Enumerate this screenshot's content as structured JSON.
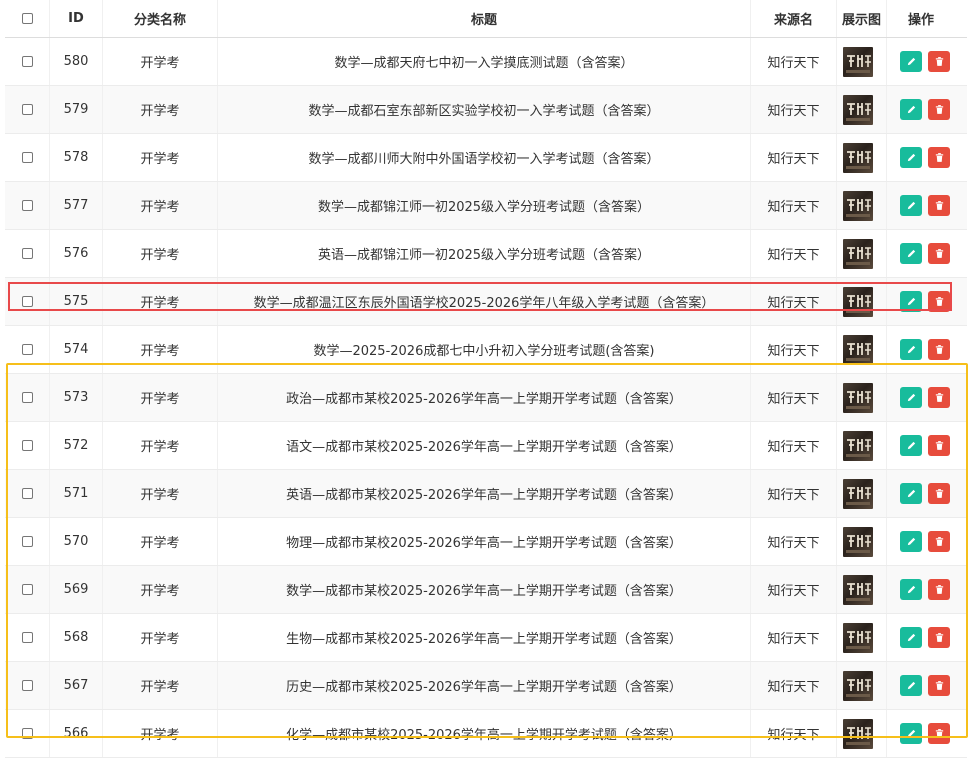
{
  "header": {
    "id": "ID",
    "category": "分类名称",
    "title": "标题",
    "source": "来源名",
    "image": "展示图",
    "actions": "操作"
  },
  "rows": [
    {
      "id": "580",
      "category": "开学考",
      "title": "数学—成都天府七中初一入学摸底测试题（含答案）",
      "source": "知行天下"
    },
    {
      "id": "579",
      "category": "开学考",
      "title": "数学—成都石室东部新区实验学校初一入学考试题（含答案）",
      "source": "知行天下"
    },
    {
      "id": "578",
      "category": "开学考",
      "title": "数学—成都川师大附中外国语学校初一入学考试题（含答案）",
      "source": "知行天下"
    },
    {
      "id": "577",
      "category": "开学考",
      "title": "数学—成都锦江师一初2025级入学分班考试题（含答案）",
      "source": "知行天下"
    },
    {
      "id": "576",
      "category": "开学考",
      "title": "英语—成都锦江师一初2025级入学分班考试题（含答案）",
      "source": "知行天下"
    },
    {
      "id": "575",
      "category": "开学考",
      "title": "数学—成都温江区东辰外国语学校2025-2026学年八年级入学考试题（含答案）",
      "source": "知行天下"
    },
    {
      "id": "574",
      "category": "开学考",
      "title": "数学—2025-2026成都七中小升初入学分班考试题(含答案)",
      "source": "知行天下"
    },
    {
      "id": "573",
      "category": "开学考",
      "title": "政治—成都市某校2025-2026学年高一上学期开学考试题（含答案）",
      "source": "知行天下"
    },
    {
      "id": "572",
      "category": "开学考",
      "title": "语文—成都市某校2025-2026学年高一上学期开学考试题（含答案）",
      "source": "知行天下"
    },
    {
      "id": "571",
      "category": "开学考",
      "title": "英语—成都市某校2025-2026学年高一上学期开学考试题（含答案）",
      "source": "知行天下"
    },
    {
      "id": "570",
      "category": "开学考",
      "title": "物理—成都市某校2025-2026学年高一上学期开学考试题（含答案）",
      "source": "知行天下"
    },
    {
      "id": "569",
      "category": "开学考",
      "title": "数学—成都市某校2025-2026学年高一上学期开学考试题（含答案）",
      "source": "知行天下"
    },
    {
      "id": "568",
      "category": "开学考",
      "title": "生物—成都市某校2025-2026学年高一上学期开学考试题（含答案）",
      "source": "知行天下"
    },
    {
      "id": "567",
      "category": "开学考",
      "title": "历史—成都市某校2025-2026学年高一上学期开学考试题（含答案）",
      "source": "知行天下"
    },
    {
      "id": "566",
      "category": "开学考",
      "title": "化学—成都市某校2025-2026学年高一上学期开学考试题（含答案）",
      "source": "知行天下"
    }
  ],
  "icons": {
    "edit": "pencil-icon",
    "delete": "trash-icon",
    "thumb": "thumbnail-image"
  },
  "colors": {
    "edit_button": "#18bc9c",
    "delete_button": "#e74c3c",
    "highlight_red": "#e8494a",
    "highlight_yellow": "#f6bf1a"
  }
}
